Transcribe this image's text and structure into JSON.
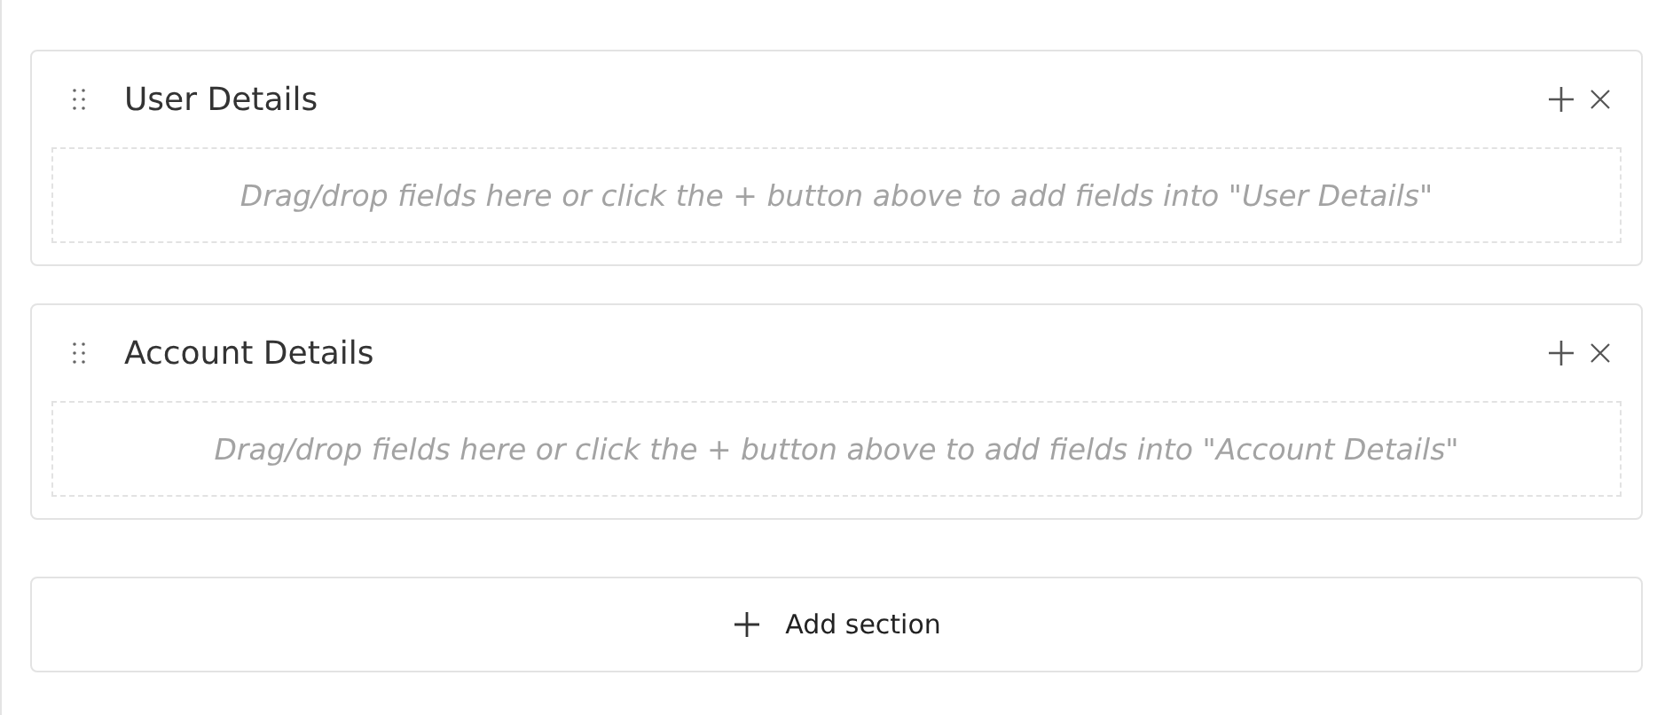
{
  "sections": [
    {
      "title": "User Details",
      "hint": "Drag/drop fields here or click the + button above to add fields into \"User Details\""
    },
    {
      "title": "Account Details",
      "hint": "Drag/drop fields here or click the + button above to add fields into \"Account Details\""
    }
  ],
  "add_button": {
    "label": "Add section"
  }
}
